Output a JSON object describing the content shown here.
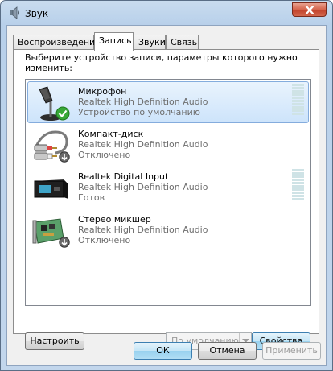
{
  "window": {
    "title": "Звук"
  },
  "tabs": [
    {
      "label": "Воспроизведение",
      "active": false
    },
    {
      "label": "Запись",
      "active": true
    },
    {
      "label": "Звуки",
      "active": false
    },
    {
      "label": "Связь",
      "active": false
    }
  ],
  "instruction": "Выберите устройство записи, параметры которого нужно изменить:",
  "devices": [
    {
      "name": "Микрофон",
      "driver": "Realtek High Definition Audio",
      "status": "Устройство по умолчанию",
      "icon": "microphone-icon",
      "badge": "default-check-icon",
      "selected": true,
      "meter_level": 0
    },
    {
      "name": "Компакт-диск",
      "driver": "Realtek High Definition Audio",
      "status": "Отключено",
      "icon": "cd-audio-cable-icon",
      "badge": "disabled-arrow-icon",
      "selected": false
    },
    {
      "name": "Realtek Digital Input",
      "driver": "Realtek High Definition Audio",
      "status": "Готов",
      "icon": "digital-input-device-icon",
      "badge": "",
      "selected": false,
      "meter_level": 0
    },
    {
      "name": "Стерео микшер",
      "driver": "Realtek High Definition Audio",
      "status": "Отключено",
      "icon": "sound-card-icon",
      "badge": "disabled-arrow-icon",
      "selected": false
    }
  ],
  "buttons": {
    "configure": "Настроить",
    "set_default": "По умолчанию",
    "properties": "Свойства",
    "ok": "ОК",
    "cancel": "Отмена",
    "apply": "Применить"
  },
  "colors": {
    "selection": "#cde4fb",
    "selection_border": "#84acdd",
    "secondary_text": "#6d6d6d",
    "meter": "#cfe3e6",
    "close_button": "#c1402a"
  }
}
